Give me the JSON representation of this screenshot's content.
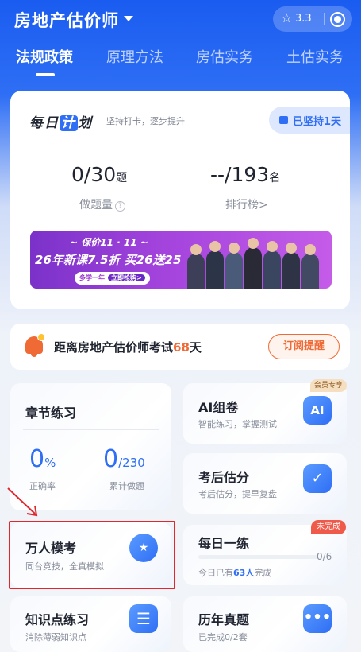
{
  "header": {
    "title": "房地产估价师",
    "rating": "3.3"
  },
  "tabs": [
    "法规政策",
    "原理方法",
    "房估实务",
    "土估实务"
  ],
  "plan": {
    "logo_part1": "每日",
    "logo_highlight": "计",
    "logo_part2": "划",
    "slogan": "坚持打卡，逐步提升",
    "streak": "已坚持1天",
    "questions_value": "0/30",
    "questions_unit": "题",
    "questions_label": "做题量",
    "rank_value": "--/193",
    "rank_unit": "名",
    "rank_label": "排行榜>"
  },
  "banner": {
    "top": "~ 保价11 · 11 ~",
    "main": "26年新课7.5折  买26送25",
    "chip": "多学一年",
    "cta": "立即抢购>"
  },
  "countdown": {
    "prefix": "距离房地产估价师考试",
    "days": "68",
    "suffix": "天",
    "button": "订阅提醒"
  },
  "chapter": {
    "title": "章节练习",
    "accuracy_value": "0",
    "accuracy_unit": "%",
    "accuracy_label": "正确率",
    "done_value": "0",
    "done_total": "/230",
    "done_label": "累计做题"
  },
  "ai_paper": {
    "title": "AI组卷",
    "subtitle": "智能练习，掌握测试",
    "badge": "会员专享",
    "icon_text": "AI"
  },
  "estimate": {
    "title": "考后估分",
    "subtitle": "考后估分，提早复盘"
  },
  "mock": {
    "title": "万人模考",
    "subtitle": "同台竞技，全真模拟"
  },
  "daily": {
    "title": "每日一练",
    "badge": "未完成",
    "progress_text": "0/6",
    "progress": 0,
    "done_prefix": "今日已有",
    "done_count": "63人",
    "done_suffix": "完成"
  },
  "knowledge": {
    "title": "知识点练习",
    "subtitle": "消除薄弱知识点"
  },
  "past_papers": {
    "title": "历年真题",
    "subtitle": "已完成0/2套"
  },
  "colors": {
    "primary": "#2f6ff5",
    "accent": "#f06a36",
    "highlight": "#e0272d"
  }
}
